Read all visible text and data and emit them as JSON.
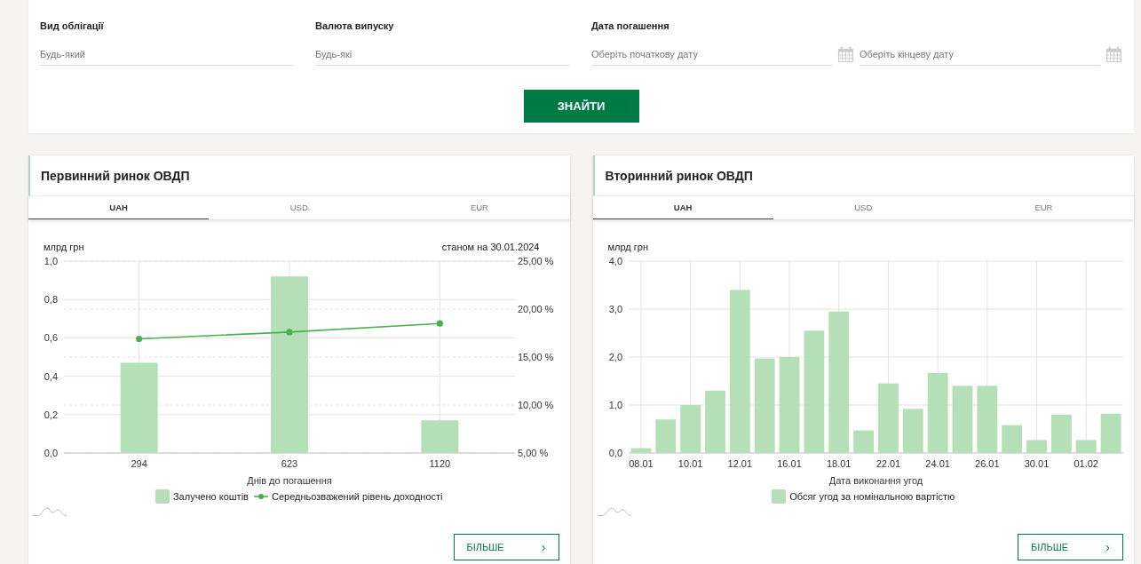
{
  "filters": [
    {
      "label": "Вид облігації",
      "fields": [
        {
          "kind": "text",
          "placeholder": "Будь-який"
        }
      ]
    },
    {
      "label": "Валюта випуску",
      "fields": [
        {
          "kind": "text",
          "placeholder": "Будь-які"
        }
      ]
    },
    {
      "label": "Дата погашення",
      "fields": [
        {
          "kind": "date",
          "placeholder": "Оберіть початкову дату"
        },
        {
          "kind": "date",
          "placeholder": "Оберіть кінцеву дату"
        }
      ]
    }
  ],
  "search_button": "ЗНАЙТИ",
  "panels": [
    {
      "title": "Первинний ринок ОВДП",
      "tabs": [
        {
          "label": "UAH",
          "selected": true
        },
        {
          "label": "USD",
          "selected": false
        },
        {
          "label": "EUR",
          "selected": false
        }
      ],
      "as_of": "станом на 30.01.2024",
      "chart_data": {
        "type": "bar",
        "grid": true,
        "ylabel": "млрд грн",
        "xlabel": "Днів до погашення",
        "categories": [
          "294",
          "623",
          "1120"
        ],
        "ylim": [
          0,
          1
        ],
        "yticks": [
          {
            "value": 0,
            "label": "0,0"
          },
          {
            "value": 0.2,
            "label": "0,2"
          },
          {
            "value": 0.4,
            "label": "0,4"
          },
          {
            "value": 0.6,
            "label": "0,6"
          },
          {
            "value": 0.8,
            "label": "0,8"
          },
          {
            "value": 1,
            "label": "1,0"
          }
        ],
        "y2lim": [
          5,
          25
        ],
        "y2ticks": [
          {
            "value": 5,
            "label": "5,00 %"
          },
          {
            "value": 10,
            "label": "10,00 %"
          },
          {
            "value": 15,
            "label": "15,00 %"
          },
          {
            "value": 20,
            "label": "20,00 %"
          },
          {
            "value": 25,
            "label": "25,00 %"
          }
        ],
        "series": [
          {
            "name": "Залучено коштів",
            "color": "#b5dfb7",
            "values": [
              0.47,
              0.92,
              0.17
            ]
          },
          {
            "name": "Середньозважений рівень доходності",
            "type": "line",
            "axis": "y2",
            "marker": true,
            "color": "#4caf50",
            "values": [
              16.9,
              17.6,
              18.5
            ]
          }
        ]
      },
      "more_button": {
        "label": "БІЛЬШЕ",
        "icon": "›"
      }
    },
    {
      "title": "Вторинний ринок ОВДП",
      "tabs": [
        {
          "label": "UAH",
          "selected": true
        },
        {
          "label": "USD",
          "selected": false
        },
        {
          "label": "EUR",
          "selected": false
        }
      ],
      "chart_data": {
        "type": "bar",
        "grid": true,
        "ylabel": "млрд грн",
        "xlabel": "Дата виконання угод",
        "categories": [
          "08.01",
          null,
          "10.01",
          null,
          "12.01",
          null,
          "16.01",
          null,
          "18.01",
          null,
          "22.01",
          null,
          "24.01",
          null,
          "26.01",
          null,
          "30.01",
          null,
          "01.02",
          null
        ],
        "ylim": [
          0,
          4
        ],
        "yticks": [
          {
            "value": 0,
            "label": "0,0"
          },
          {
            "value": 1,
            "label": "1,0"
          },
          {
            "value": 2,
            "label": "2,0"
          },
          {
            "value": 3,
            "label": "3,0"
          },
          {
            "value": 4,
            "label": "4,0"
          }
        ],
        "series": [
          {
            "name": "Обсяг угод за номінальною вартістю",
            "color": "#b5dfb7",
            "values": [
              0.1,
              0.7,
              1.0,
              1.3,
              3.4,
              1.97,
              2.0,
              2.55,
              2.95,
              0.47,
              1.45,
              0.92,
              1.67,
              1.4,
              1.4,
              0.58,
              0.27,
              0.8,
              0.27,
              0.82
            ]
          }
        ]
      },
      "more_button": {
        "label": "БІЛЬШЕ",
        "icon": "›"
      }
    }
  ]
}
